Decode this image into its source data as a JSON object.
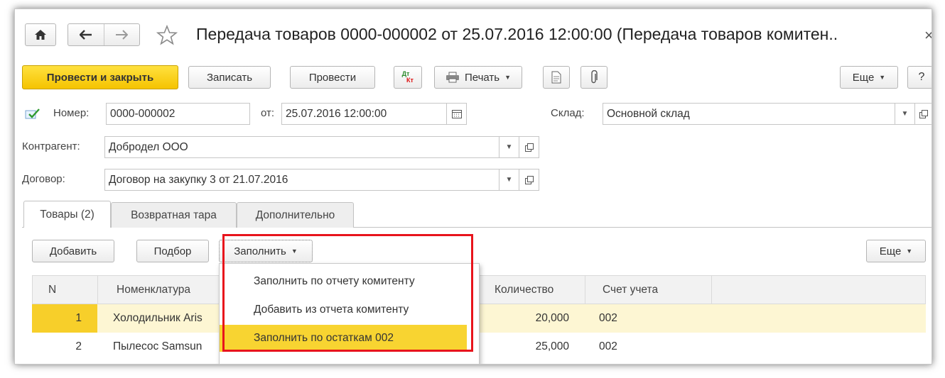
{
  "window": {
    "title": "Передача товаров 0000-000002 от 25.07.2016 12:00:00 (Передача товаров комитен..",
    "close_glyph": "×"
  },
  "nav": {
    "home_icon": "home-icon",
    "back_icon": "arrow-left-icon",
    "forward_icon": "arrow-right-icon",
    "star_icon": "star-icon"
  },
  "toolbar": {
    "post_close": "Провести и закрыть",
    "save": "Записать",
    "post": "Провести",
    "dt_top": "Дт",
    "dt_bottom": "Кт",
    "print": "Печать",
    "more": "Еще",
    "help": "?"
  },
  "header": {
    "number_label": "Номер:",
    "number_value": "0000-000002",
    "date_label": "от:",
    "date_value": "25.07.2016 12:00:00",
    "warehouse_label": "Склад:",
    "warehouse_value": "Основной склад",
    "counterparty_label": "Контрагент:",
    "counterparty_value": "Добродел ООО",
    "contract_label": "Договор:",
    "contract_value": "Договор на закупку 3 от 21.07.2016"
  },
  "tabs": [
    {
      "label": "Товары (2)",
      "active": true
    },
    {
      "label": "Возвратная тара",
      "active": false
    },
    {
      "label": "Дополнительно",
      "active": false
    }
  ],
  "table_toolbar": {
    "add": "Добавить",
    "pick": "Подбор",
    "fill": "Заполнить",
    "more": "Еще"
  },
  "fill_menu": [
    {
      "label": "Заполнить по отчету комитенту",
      "highlighted": false
    },
    {
      "label": "Добавить из отчета комитенту",
      "highlighted": false
    },
    {
      "label": "Заполнить по остаткам 002",
      "highlighted": true
    }
  ],
  "table": {
    "columns": [
      "N",
      "Номенклатура",
      "Количество",
      "Счет учета"
    ],
    "rows": [
      {
        "n": "1",
        "item": "Холодильник Aris",
        "qty": "20,000",
        "account": "002",
        "selected": true
      },
      {
        "n": "2",
        "item": "Пылесос Samsun",
        "qty": "25,000",
        "account": "002",
        "selected": false
      }
    ]
  },
  "colors": {
    "primary_button": "#f5c300",
    "selected_row": "#fdf6d3",
    "selected_num_cell": "#f7cf2a",
    "highlight_item": "#f8d431",
    "annotation_box": "#e8141c"
  }
}
